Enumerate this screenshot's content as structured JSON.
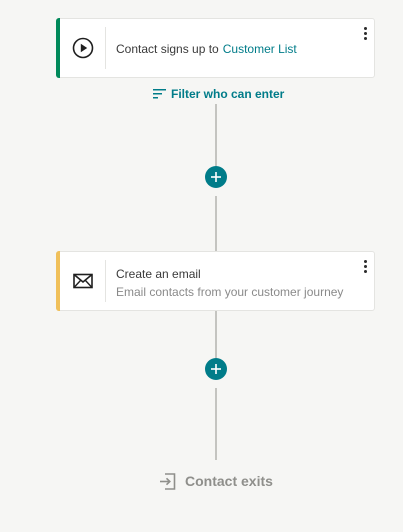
{
  "trigger": {
    "label": "Contact signs up to",
    "list_link": "Customer List",
    "stripe_color": "#00895a",
    "icon": "play-circle-icon"
  },
  "filter": {
    "label": "Filter who can enter",
    "icon": "filter-lines-icon"
  },
  "steps": [
    {
      "title": "Create an email",
      "subtitle": "Email contacts from your customer journey",
      "stripe_color": "#f0c05a",
      "icon": "envelope-icon"
    }
  ],
  "add_step": {
    "icon": "plus-icon"
  },
  "exit": {
    "label": "Contact exits",
    "icon": "exit-arrow-icon"
  },
  "colors": {
    "accent": "#007c89",
    "background": "#f6f6f4"
  }
}
